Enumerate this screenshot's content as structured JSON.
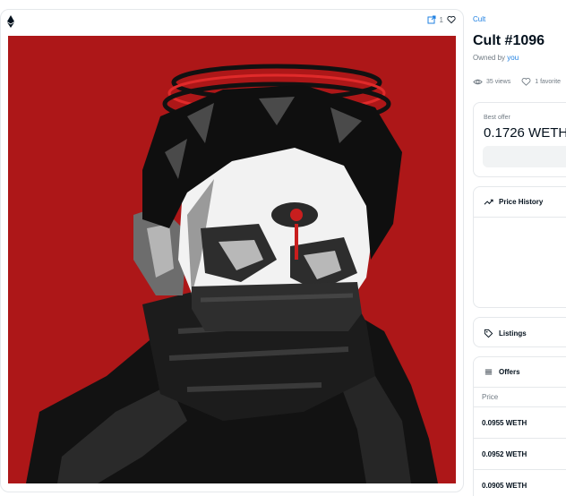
{
  "media": {
    "chain_icon": "ethereum-icon",
    "external_link_icon": "external-link-icon",
    "favorite_count": "1",
    "heart_icon": "heart-icon",
    "art_background": "#ad1718"
  },
  "item": {
    "collection": "Cult",
    "title": "Cult #1096",
    "owned_by_label": "Owned by",
    "owner": "you",
    "views": "35 views",
    "favorites": "1 favorite"
  },
  "best_offer": {
    "label": "Best offer",
    "value": "0.1726 WETH"
  },
  "price_history": {
    "title": "Price History"
  },
  "listings": {
    "title": "Listings"
  },
  "offers": {
    "title": "Offers",
    "column_price": "Price",
    "rows": [
      "0.0955 WETH",
      "0.0952 WETH",
      "0.0905 WETH"
    ]
  },
  "colors": {
    "accent": "#2081e2",
    "muted": "#707a83",
    "text": "#04111d",
    "border": "#e5e8eb"
  }
}
